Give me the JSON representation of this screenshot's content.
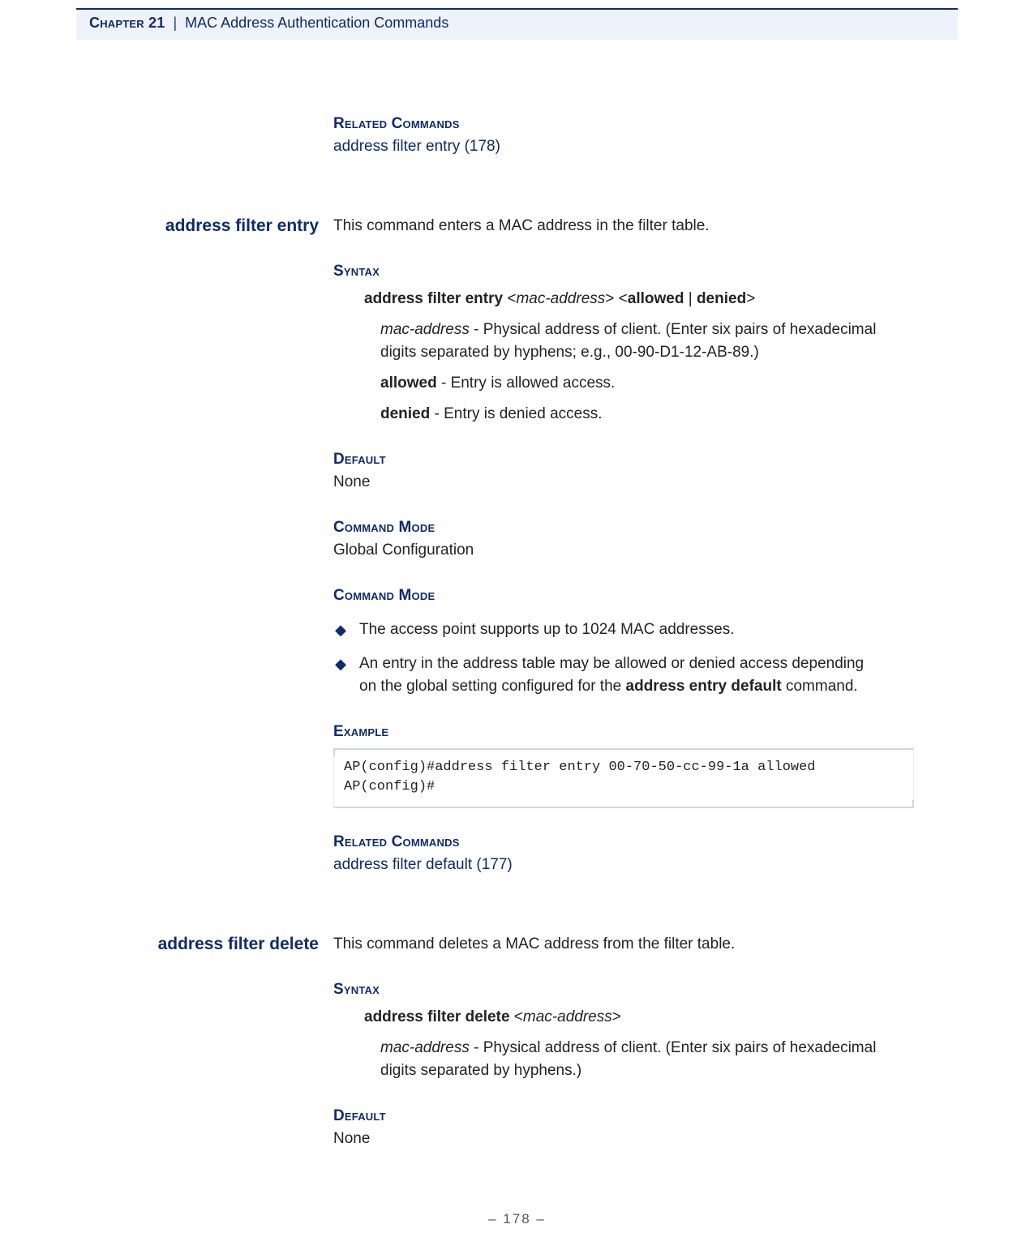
{
  "header": {
    "chapter_label": "Chapter 21",
    "separator": "|",
    "title": "MAC Address Authentication Commands"
  },
  "intro_related": {
    "heading": "Related Commands",
    "link_text": "address filter entry (178)"
  },
  "sections": [
    {
      "name": "address filter entry",
      "summary": "This command enters a MAC address in the filter table.",
      "syntax": {
        "heading": "Syntax",
        "line": {
          "cmd": "address filter entry",
          "lt1": " <",
          "arg1": "mac-address",
          "gt1": "> <",
          "opt1": "allowed",
          "pipe": " | ",
          "opt2": "denied",
          "gt2": ">"
        },
        "params": [
          {
            "term": "mac-address",
            "term_italic": true,
            "desc": " - Physical address of client. (Enter six pairs of hexadecimal digits separated by hyphens; e.g., 00-90-D1-12-AB-89.)"
          },
          {
            "term": "allowed",
            "term_italic": false,
            "desc": " - Entry is allowed access."
          },
          {
            "term": "denied",
            "term_italic": false,
            "desc": " - Entry is denied access."
          }
        ]
      },
      "default": {
        "heading": "Default",
        "value": "None"
      },
      "mode": {
        "heading": "Command Mode",
        "value": "Global Configuration"
      },
      "usage": {
        "heading": "Command Mode",
        "bullets": [
          {
            "prefix": "",
            "text": "The access point supports up to 1024 MAC addresses.",
            "bold_inline": "",
            "suffix": ""
          },
          {
            "prefix": "An entry in the address table may be allowed or denied access depending on the global setting configured for the ",
            "text": "",
            "bold_inline": "address entry default",
            "suffix": " command."
          }
        ]
      },
      "example": {
        "heading": "Example",
        "text": "AP(config)#address filter entry 00-70-50-cc-99-1a allowed\nAP(config)#"
      },
      "related": {
        "heading": "Related Commands",
        "link_text": "address filter default (177)"
      }
    },
    {
      "name": "address filter delete",
      "summary": "This command deletes a MAC address from the filter table.",
      "syntax": {
        "heading": "Syntax",
        "line": {
          "cmd": "address filter delete",
          "lt1": " <",
          "arg1": "mac-address",
          "gt1": ">",
          "opt1": "",
          "pipe": "",
          "opt2": "",
          "gt2": ""
        },
        "params": [
          {
            "term": "mac-address",
            "term_italic": true,
            "desc": " - Physical address of client. (Enter six pairs of hexadecimal digits separated by hyphens.)"
          }
        ]
      },
      "default": {
        "heading": "Default",
        "value": "None"
      }
    }
  ],
  "footer": {
    "page_number": "–  178  –"
  }
}
